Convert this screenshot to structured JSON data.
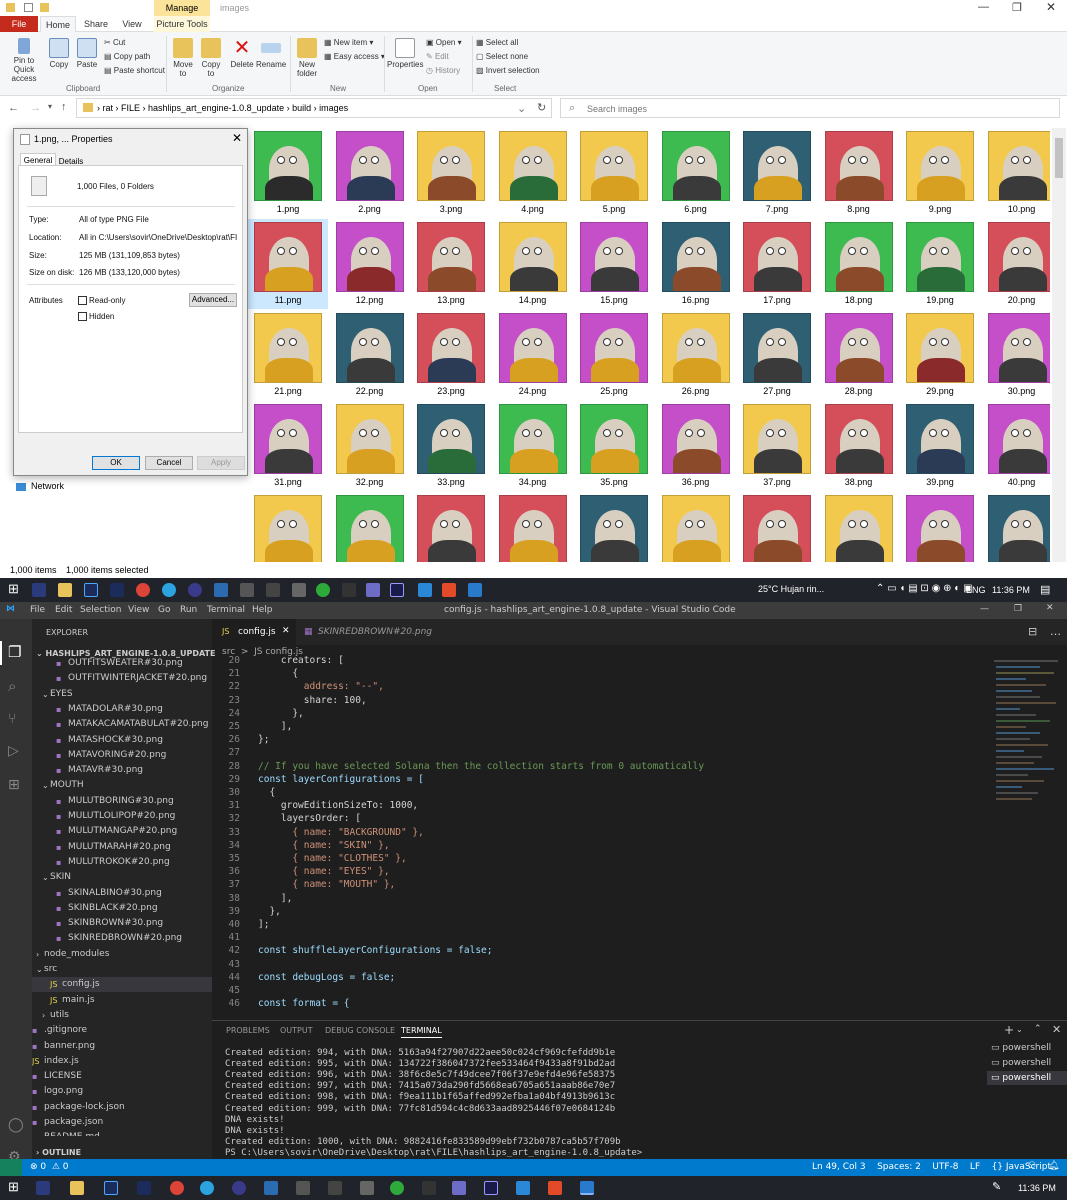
{
  "explorer": {
    "title": "images",
    "manage_tab": "Manage",
    "tabs": [
      "File",
      "Home",
      "Share",
      "View",
      "Picture Tools"
    ],
    "clipboard": {
      "pin": "Pin to Quick access",
      "copy": "Copy",
      "paste": "Paste",
      "cut": "Cut",
      "copy_path": "Copy path",
      "paste_shortcut": "Paste shortcut",
      "group": "Clipboard"
    },
    "organize": {
      "move": "Move to",
      "copy": "Copy to",
      "delete": "Delete",
      "rename": "Rename",
      "group": "Organize"
    },
    "new": {
      "folder": "New folder",
      "item": "New item",
      "easy": "Easy access",
      "group": "New"
    },
    "open": {
      "properties": "Properties",
      "open": "Open",
      "edit": "Edit",
      "history": "History",
      "group": "Open"
    },
    "select": {
      "all": "Select all",
      "none": "Select none",
      "invert": "Invert selection",
      "group": "Select"
    },
    "breadcrumb": [
      "rat",
      "FILE",
      "hashlips_art_engine-1.0.8_update",
      "build",
      "images"
    ],
    "search_placeholder": "Search images",
    "network": "Network",
    "status_items": "1,000 items",
    "status_selected": "1,000 items selected",
    "files": [
      "1.png",
      "2.png",
      "3.png",
      "4.png",
      "5.png",
      "6.png",
      "7.png",
      "8.png",
      "9.png",
      "10.png",
      "11.png",
      "12.png",
      "13.png",
      "14.png",
      "15.png",
      "16.png",
      "17.png",
      "18.png",
      "19.png",
      "20.png",
      "21.png",
      "22.png",
      "23.png",
      "24.png",
      "25.png",
      "26.png",
      "27.png",
      "28.png",
      "29.png",
      "30.png",
      "31.png",
      "32.png",
      "33.png",
      "34.png",
      "35.png",
      "36.png",
      "37.png",
      "38.png",
      "39.png",
      "40.png",
      "",
      "",
      "",
      "",
      "",
      "",
      "",
      "",
      "",
      ""
    ],
    "bg_colors": [
      "#3dbb50",
      "#c44fc9",
      "#f2c94c",
      "#f2c94c",
      "#f2c94c",
      "#3dbb50",
      "#2f5f73",
      "#d44f5a",
      "#f2c94c",
      "#f2c94c",
      "#d44f5a",
      "#c44fc9",
      "#d44f5a",
      "#f2c94c",
      "#c44fc9",
      "#2f5f73",
      "#d44f5a",
      "#3dbb50",
      "#3dbb50",
      "#d44f5a",
      "#f2c94c",
      "#2f5f73",
      "#d44f5a",
      "#c44fc9",
      "#c44fc9",
      "#f2c94c",
      "#2f5f73",
      "#c44fc9",
      "#f2c94c",
      "#c44fc9",
      "#c44fc9",
      "#f2c94c",
      "#2f5f73",
      "#3dbb50",
      "#3dbb50",
      "#c44fc9",
      "#f2c94c",
      "#d44f5a",
      "#2f5f73",
      "#c44fc9",
      "#f2c94c",
      "#3dbb50",
      "#d44f5a",
      "#d44f5a",
      "#2f5f73",
      "#f2c94c",
      "#d44f5a",
      "#f2c94c",
      "#c44fc9",
      "#2f5f73"
    ],
    "suit_colors": [
      "#2b2b2b",
      "#2b3a55",
      "#8b4a2a",
      "#2a6b3a",
      "#d8a020",
      "#3a3a3a",
      "#d8a020",
      "#8b4a2a",
      "#d8a020",
      "#3a3a3a",
      "#d8a020",
      "#8b2a2a",
      "#8b4a2a",
      "#3a3a3a",
      "#3a3a3a",
      "#8b4a2a",
      "#3a3a3a",
      "#8b4a2a",
      "#2a6b3a",
      "#3a3a3a",
      "#d8a020",
      "#3a3a3a",
      "#2b3a55",
      "#d8a020",
      "#d8a020",
      "#d8a020",
      "#3a3a3a",
      "#8b4a2a",
      "#8b2a2a",
      "#3a3a3a",
      "#3a3a3a",
      "#d8a020",
      "#2a6b3a",
      "#d8a020",
      "#d8a020",
      "#8b4a2a",
      "#3a3a3a",
      "#3a3a3a",
      "#2b3a55",
      "#3a3a3a",
      "#d8a020",
      "#d8a020",
      "#3a3a3a",
      "#d8a020",
      "#3a3a3a",
      "#d8a020",
      "#8b4a2a",
      "#3a3a3a",
      "#8b4a2a",
      "#3a3a3a"
    ]
  },
  "dialog": {
    "title": "1.png, ... Properties",
    "tab_general": "General",
    "tab_details": "Details",
    "files_folders": "1,000 Files, 0 Folders",
    "type_label": "Type:",
    "type_value": "All of type PNG File",
    "location_label": "Location:",
    "location_value": "All in C:\\Users\\sovir\\OneDrive\\Desktop\\rat\\FILE\\h",
    "size_label": "Size:",
    "size_value": "125 MB (131,109,853 bytes)",
    "disk_label": "Size on disk:",
    "disk_value": "126 MB (133,120,000 bytes)",
    "attributes_label": "Attributes",
    "readonly": "Read-only",
    "hidden": "Hidden",
    "advanced": "Advanced...",
    "ok": "OK",
    "cancel": "Cancel",
    "apply": "Apply"
  },
  "taskbar_top": {
    "weather": "25°C  Hujan rin...",
    "lang": "ENG",
    "time": "11:36 PM"
  },
  "taskbar_bottom": {
    "time": "11:36 PM"
  },
  "vscode": {
    "menu": [
      "File",
      "Edit",
      "Selection",
      "View",
      "Go",
      "Run",
      "Terminal",
      "Help"
    ],
    "title": "config.js - hashlips_art_engine-1.0.8_update - Visual Studio Code",
    "explorer_title": "EXPLORER",
    "project": "HASHLIPS_ART_ENGINE-1.0.8_UPDATE",
    "tree": [
      {
        "t": "OUTFITSWEATER#30.png",
        "i": 36
      },
      {
        "t": "OUTFITWINTERJACKET#20.png",
        "i": 36
      },
      {
        "t": "EYES",
        "i": 18,
        "folder": true
      },
      {
        "t": "MATADOLAR#30.png",
        "i": 36
      },
      {
        "t": "MATAKACAMATABULAT#20.png",
        "i": 36
      },
      {
        "t": "MATASHOCK#30.png",
        "i": 36
      },
      {
        "t": "MATAVORING#20.png",
        "i": 36
      },
      {
        "t": "MATAVR#30.png",
        "i": 36
      },
      {
        "t": "MOUTH",
        "i": 18,
        "folder": true
      },
      {
        "t": "MULUTBORING#30.png",
        "i": 36
      },
      {
        "t": "MULUTLOLIPOP#20.png",
        "i": 36
      },
      {
        "t": "MULUTMANGAP#20.png",
        "i": 36
      },
      {
        "t": "MULUTMARAH#20.png",
        "i": 36
      },
      {
        "t": "MULUTROKOK#20.png",
        "i": 36
      },
      {
        "t": "SKIN",
        "i": 18,
        "folder": true
      },
      {
        "t": "SKINALBINO#30.png",
        "i": 36
      },
      {
        "t": "SKINBLACK#20.png",
        "i": 36
      },
      {
        "t": "SKINBROWN#30.png",
        "i": 36
      },
      {
        "t": "SKINREDBROWN#20.png",
        "i": 36
      },
      {
        "t": "node_modules",
        "i": 12,
        "folder": true
      },
      {
        "t": "src",
        "i": 12,
        "folder": true
      },
      {
        "t": "config.js",
        "i": 30,
        "js": true
      },
      {
        "t": "main.js",
        "i": 30,
        "js": true
      },
      {
        "t": "utils",
        "i": 18,
        "folder": true
      },
      {
        "t": ".gitignore",
        "i": 12
      },
      {
        "t": "banner.png",
        "i": 12
      },
      {
        "t": "index.js",
        "i": 12,
        "js": true
      },
      {
        "t": "LICENSE",
        "i": 12
      },
      {
        "t": "logo.png",
        "i": 12
      },
      {
        "t": "package-lock.json",
        "i": 12
      },
      {
        "t": "package.json",
        "i": 12
      },
      {
        "t": "README.md",
        "i": 12
      }
    ],
    "outline": "OUTLINE",
    "tab_active": "config.js",
    "tab_other": "SKINREDBROWN#20.png",
    "breadcrumb": "src  >  JS config.js",
    "code": [
      {
        "n": "20",
        "s": "    creators: ["
      },
      {
        "n": "21",
        "s": "      {"
      },
      {
        "n": "22",
        "s": "        address: \"--\","
      },
      {
        "n": "23",
        "s": "        share: 100,"
      },
      {
        "n": "24",
        "s": "      },"
      },
      {
        "n": "25",
        "s": "    ],"
      },
      {
        "n": "26",
        "s": "};"
      },
      {
        "n": "27",
        "s": ""
      },
      {
        "n": "28",
        "s": "// If you have selected Solana then the collection starts from 0 automatically"
      },
      {
        "n": "29",
        "s": "const layerConfigurations = ["
      },
      {
        "n": "30",
        "s": "  {"
      },
      {
        "n": "31",
        "s": "    growEditionSizeTo: 1000,"
      },
      {
        "n": "32",
        "s": "    layersOrder: ["
      },
      {
        "n": "33",
        "s": "      { name: \"BACKGROUND\" },"
      },
      {
        "n": "34",
        "s": "      { name: \"SKIN\" },"
      },
      {
        "n": "35",
        "s": "      { name: \"CLOTHES\" },"
      },
      {
        "n": "36",
        "s": "      { name: \"EYES\" },"
      },
      {
        "n": "37",
        "s": "      { name: \"MOUTH\" },"
      },
      {
        "n": "38",
        "s": "    ],"
      },
      {
        "n": "39",
        "s": "  },"
      },
      {
        "n": "40",
        "s": "];"
      },
      {
        "n": "41",
        "s": ""
      },
      {
        "n": "42",
        "s": "const shuffleLayerConfigurations = false;"
      },
      {
        "n": "43",
        "s": ""
      },
      {
        "n": "44",
        "s": "const debugLogs = false;"
      },
      {
        "n": "45",
        "s": ""
      },
      {
        "n": "46",
        "s": "const format = {"
      }
    ],
    "panel_tabs": [
      "PROBLEMS",
      "OUTPUT",
      "DEBUG CONSOLE",
      "TERMINAL"
    ],
    "terminal": [
      "Created edition: 994, with DNA: 5163a94f27907d22aee50c024cf969cfefdd9b1e",
      "Created edition: 995, with DNA: 134722f386047372fee533464f9433a8f91bd2ad",
      "Created edition: 996, with DNA: 38f6c8e5c7f49dcee7f06f37e9efd4e96fe58375",
      "Created edition: 997, with DNA: 7415a073da290fd5668ea6705a651aaab86e70e7",
      "Created edition: 998, with DNA: f9ea111b1f65affed992efba1a04bf4913b9613c",
      "Created edition: 999, with DNA: 77fc81d594c4c8d633aad8925446f07e0684124b",
      "DNA exists!",
      "DNA exists!",
      "Created edition: 1000, with DNA: 9882416fe833589d99ebf732b0787ca5b57f709b",
      "PS C:\\Users\\sovir\\OneDrive\\Desktop\\rat\\FILE\\hashlips_art_engine-1.0.8_update> "
    ],
    "shells": [
      "powershell",
      "powershell",
      "powershell"
    ],
    "status_left": "⊗ 0  ⚠ 0",
    "status_right": "Ln 49, Col 3    Spaces: 2    UTF-8    LF    {} JavaScript"
  }
}
